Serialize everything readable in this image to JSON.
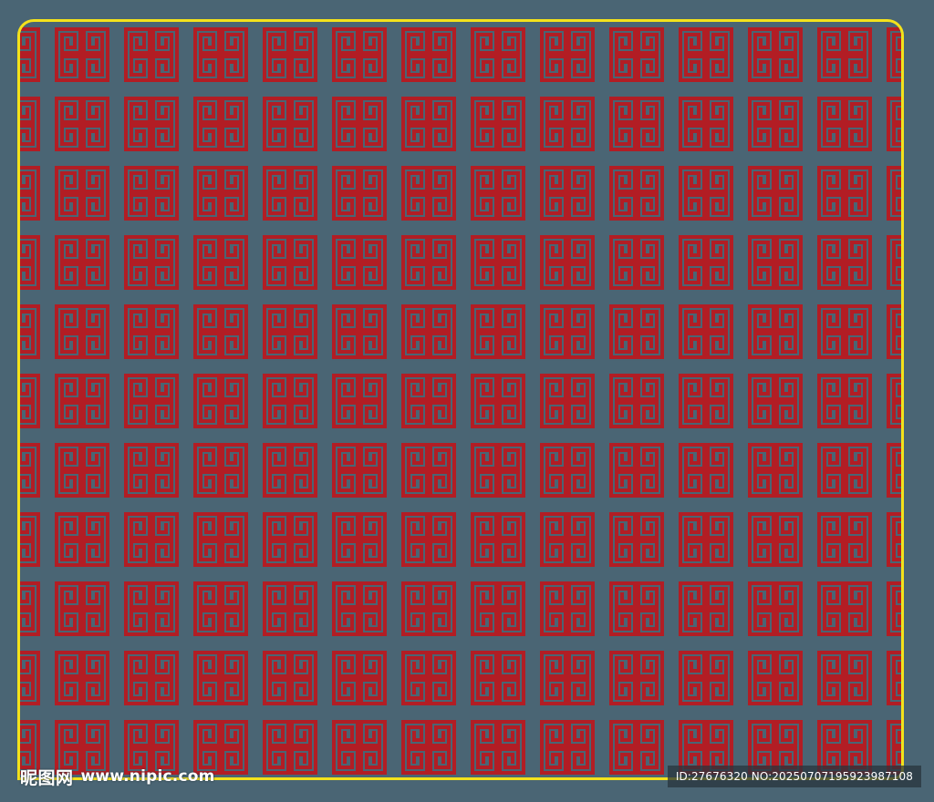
{
  "colors": {
    "background": "#4a6574",
    "frame": "#f4e21b",
    "motif": "#b21d24"
  },
  "pattern": {
    "motif_name": "fret-square-motif",
    "columns": 13,
    "rows": 11
  },
  "watermark": {
    "brand": "昵图网",
    "site": "www.nipic.com",
    "id_text": "ID:27676320 NO:20250707195923987108"
  }
}
